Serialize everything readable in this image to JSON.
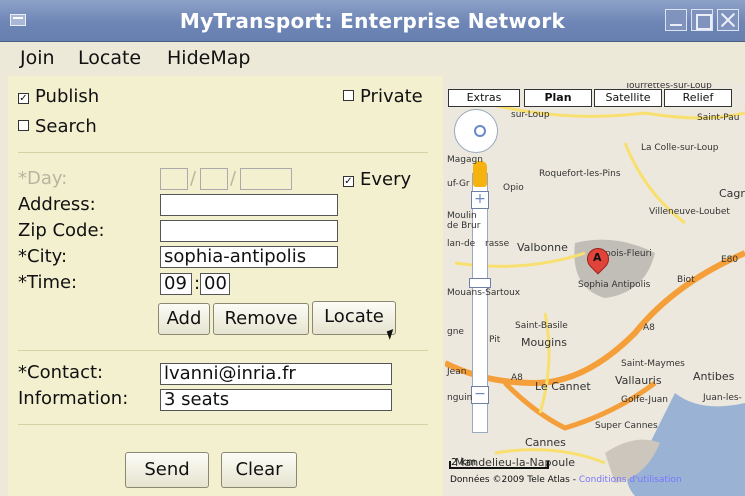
{
  "window": {
    "title": "MyTransport: Enterprise Network"
  },
  "menu": {
    "join": "Join",
    "locate": "Locate",
    "hidemap": "HideMap"
  },
  "form": {
    "publish": {
      "label": "Publish",
      "checked": true
    },
    "private": {
      "label": "Private",
      "checked": false
    },
    "search": {
      "label": "Search",
      "checked": false
    },
    "day_label": "*Day:",
    "every": {
      "label": "Every",
      "checked": true
    },
    "address_label": "Address:",
    "address_value": "",
    "zip_label": "Zip Code:",
    "zip_value": "",
    "city_label": "*City:",
    "city_value": "sophia-antipolis",
    "time_label": "*Time:",
    "time_hours": "09",
    "time_minutes": "00",
    "add_button": "Add",
    "remove_button": "Remove",
    "locate_button": "Locate",
    "contact_label": "*Contact:",
    "contact_value": "lvanni@inria.fr",
    "information_label": "Information:",
    "information_value": "3 seats",
    "send_button": "Send",
    "clear_button": "Clear"
  },
  "map": {
    "types": [
      "Extras",
      "Plan",
      "Satellite",
      "Relief"
    ],
    "active_type": "Plan",
    "labels": {
      "tourrettes": "Tourrettes-sur-Loup",
      "sur_loup": "sur-Loup",
      "saint_pau": "Saint-Pau",
      "la_colle": "La Colle-sur-Loup",
      "roquefort": "Roquefort-les-Pins",
      "opio": "Opio",
      "cagn": "Cagr",
      "villeneuve": "Villeneuve-Loubet",
      "valbonne": "Valbonne",
      "biot": "Biot",
      "e80": "E80",
      "sophia": "Sophia Antipolis",
      "mouans": "Mouans-Sartoux",
      "saint_basile": "Saint-Basile",
      "mougins": "Mougins",
      "a8_1": "A8",
      "a8_2": "A8",
      "saint_maymes": "Saint-Maymes",
      "vallauris": "Vallauris",
      "antibes": "Antibes",
      "le_cannet": "Le Cannet",
      "golfe_juan": "Golfe-Juan",
      "juan_les": "Juan-les-",
      "super_cannes": "Super Cannes",
      "cannes": "Cannes",
      "mandelieu": "Mandelieu-la-Napoule",
      "pit": "Pit",
      "jean": "Jean",
      "nguin": "nguin",
      "fasse": "rasse",
      "magagn": "Magagn",
      "uf_gr": "uf-Gr",
      "moulin": "Moulin",
      "de_brur": "de Brur",
      "lan_de": "lan-de",
      "gne": "gne",
      "pois_fleuri": "pois-Fleuri",
      "marker_letter": "A"
    },
    "scale_text": "2 km",
    "copyright": "Données ©2009 Tele Atlas - ",
    "copyright_link": "Conditions d'utilisation"
  }
}
